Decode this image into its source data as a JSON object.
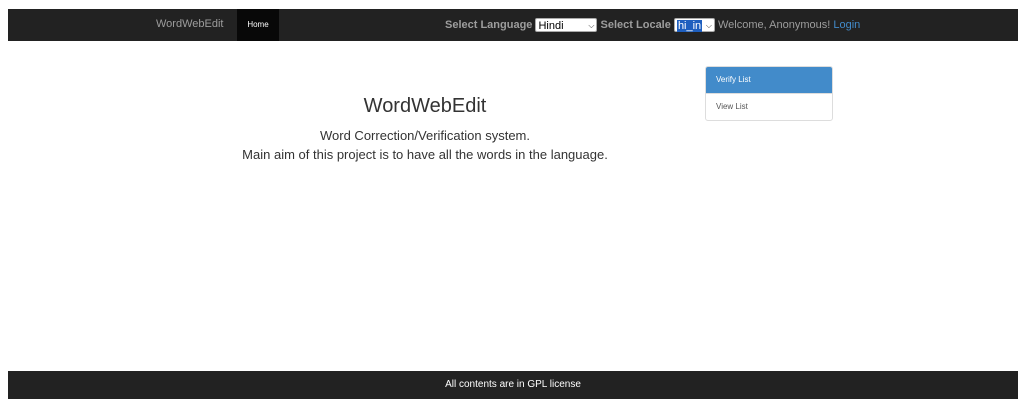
{
  "navbar": {
    "brand": "WordWebEdit",
    "home_tab": "Home",
    "select_language_label": "Select Language",
    "language_value": "Hindi",
    "select_locale_label": "Select Locale",
    "locale_value": "hi_in",
    "welcome_text": "Welcome, Anonymous!",
    "login_link": "Login",
    "dropdown_icon": "chevron-down-icon"
  },
  "main": {
    "title": "WordWebEdit",
    "line1": "Word Correction/Verification system.",
    "line2": "Main aim of this project is to have all the words in the language."
  },
  "sidebar": {
    "items": [
      {
        "label": "Verify List",
        "active": true
      },
      {
        "label": "View List",
        "active": false
      }
    ]
  },
  "footer": {
    "text": "All contents are in GPL license"
  },
  "colors": {
    "navbar_bg": "#222222",
    "active_item_bg": "#428bca",
    "link": "#428bca"
  }
}
